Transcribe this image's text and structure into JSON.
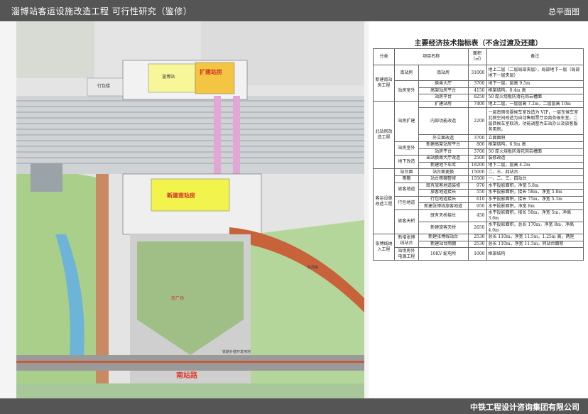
{
  "header": {
    "title": "淄博站客运设施改造工程    可行性研究（鉴修）",
    "section": "总平面图"
  },
  "footer": {
    "org": "中铁工程设计咨询集团有限公司"
  },
  "map": {
    "labels": {
      "zibo_station": "淄博站",
      "expand_station": "扩建站房",
      "freight_building": "行包楼",
      "new_south_station": "新建南站房",
      "south_square": "南广场",
      "south_road": "南站路",
      "airport_road": "机场路",
      "railway_access": "铁路补偿开发用地"
    }
  },
  "table": {
    "title": "主要经济技术指标表（不含过渡及还建）",
    "headers": [
      "分类",
      "项目名称",
      "面积（㎡）",
      "备注"
    ],
    "groups": [
      {
        "name": "新建南站房工程",
        "rows": [
          {
            "sub": "南站房",
            "item": "南站房",
            "area": "31000",
            "note": "地上二层（二层局部夹层），局部地下一层（局部地下一层夹层）"
          },
          {
            "sub": "站房室外",
            "item": "换乘大厅",
            "area": "3700",
            "note": "地下一层，层高 9.5m"
          },
          {
            "sub": "",
            "item": "高架站房平台",
            "area": "4150",
            "note": "框架结构，8.4m 高"
          },
          {
            "sub": "",
            "item": "站房平台",
            "area": "8250",
            "note": "50 厚火烧板防滑花岗岩槽面"
          }
        ]
      },
      {
        "name": "北站房改造工程",
        "rows": [
          {
            "sub": "站房扩建",
            "item": "扩建站房",
            "area": "7400",
            "note": "地上二层，一层层高 7.2m，二层层高 10m"
          },
          {
            "sub": "",
            "item": "内部功能改造",
            "area": "2200",
            "note": "一层南侧母婴候车室改造为 VIP，一层东候车室北侧空间改造为自动售取票厅及商务候车室，二层西候车室取消，功能调整为车站办公及旅客服务用房。"
          },
          {
            "sub": "",
            "item": "外立面改造",
            "area": "3700",
            "note": "立面面积"
          },
          {
            "sub": "站房室外",
            "item": "新建高架站房平台",
            "area": "800",
            "note": "框架结构，6.9m 高"
          },
          {
            "sub": "",
            "item": "站房平台",
            "area": "3700",
            "note": "50 厚火烧板防滑花岗岩槽面"
          },
          {
            "sub": "地下改造",
            "item": "出站换乘大厅改造",
            "area": "2500",
            "note": "装修改造"
          },
          {
            "sub": "",
            "item": "新建地下车库",
            "area": "18200",
            "note": "地下二层，层高 4.2m"
          }
        ]
      },
      {
        "name": "客运设施改造工程",
        "rows": [
          {
            "sub": "站台面",
            "item": "站台面更换",
            "area": "15000",
            "note": "二、三、四站台"
          },
          {
            "sub": "雨棚",
            "item": "站台雨棚整修",
            "area": "15500",
            "note": "一、二、三、四站台"
          },
          {
            "sub": "旅客地道",
            "item": "既有旅客地道装修",
            "area": "970",
            "note": "水平投影面积，净宽 5.8m"
          },
          {
            "sub": "",
            "item": "旅客地道接长",
            "area": "550",
            "note": "水平投影面积，接长 58m，净宽 5.8m"
          },
          {
            "sub": "行包地道",
            "item": "行包地道接长",
            "area": "610",
            "note": "水平投影面积，接长 75m，净宽 5.1m"
          },
          {
            "sub": "",
            "item": "新建张博线旅客地道",
            "area": "950",
            "note": "水平投影面积，净宽 8m"
          },
          {
            "sub": "旅客天桥",
            "item": "既有天桥接长",
            "area": "450",
            "note": "水平投影面积，接长 58m，净宽 5m，净高 3.6m"
          },
          {
            "sub": "",
            "item": "新建旅客天桥",
            "area": "2650",
            "note": "水平投影面积，总长 170m，净宽 8m，净高 4.0m"
          }
        ]
      },
      {
        "name": "张博线纳入工程",
        "rows": [
          {
            "sub": "新增张博线站台",
            "item": "新建张博线站台",
            "area": "2530",
            "note": "总长 110m，净宽 11.5m，1.25m 高，两座"
          },
          {
            "sub": "",
            "item": "新建站台雨棚",
            "area": "2530",
            "note": "总长 110m，净宽 11.5m，同站台面积"
          },
          {
            "sub": "站场房外电源工程",
            "item": "10KV 配电所",
            "area": "1000",
            "note": "框架结构"
          }
        ]
      }
    ]
  }
}
